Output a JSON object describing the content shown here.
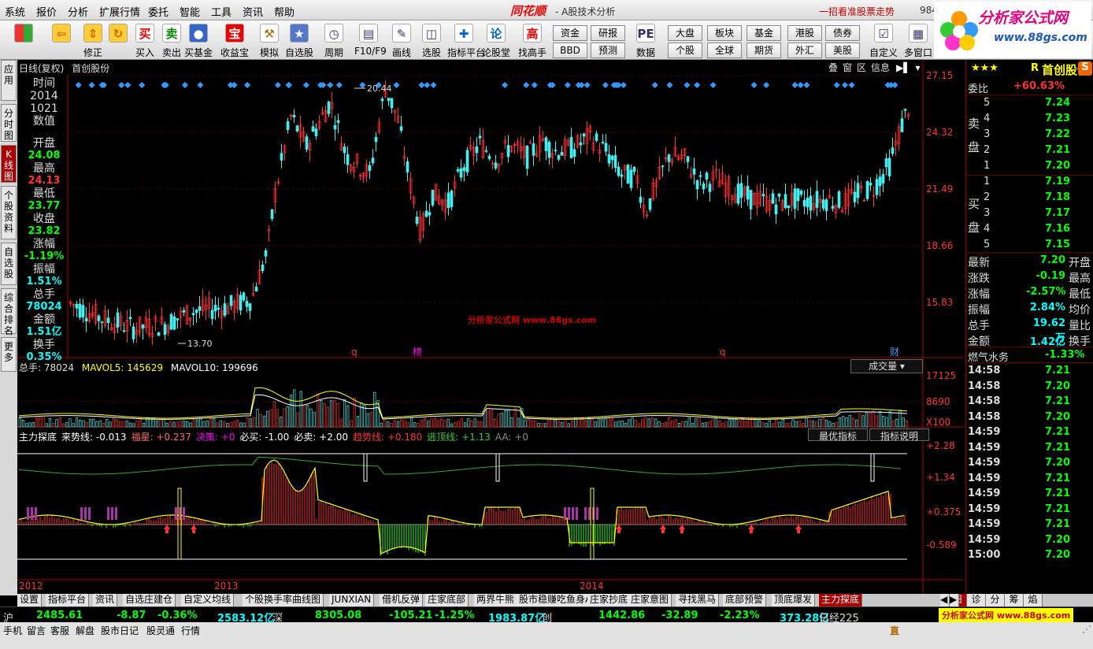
{
  "menu": [
    "系统",
    "报价",
    "分析",
    "扩展行情",
    "委托",
    "智能",
    "工具",
    "资讯",
    "帮助"
  ],
  "app_brand": "同花顺",
  "app_subtitle": "- A股技术分析",
  "promo": "一招看准股票走势",
  "menu_num": "984",
  "toolbar": [
    {
      "label": "",
      "icon": "grid-icon",
      "bg": "#e33",
      "fg": "#ff0"
    },
    {
      "label": "",
      "icon": "back-arrow-icon",
      "bg": "#fc3",
      "fg": "#c60"
    },
    {
      "label": "修正",
      "icon": "up-down-icon",
      "bg": "#fc3",
      "fg": "#c60"
    },
    {
      "label": "",
      "icon": "refresh-icon",
      "bg": "#fc3",
      "fg": "#c60"
    },
    {
      "label": "买入",
      "icon": "买",
      "bg": "#fff",
      "fg": "#e00"
    },
    {
      "label": "卖出",
      "icon": "卖",
      "bg": "#fff",
      "fg": "#080"
    },
    {
      "label": "买基金",
      "icon": "●",
      "bg": "#36c",
      "fg": "#fff"
    },
    {
      "label": "收益宝",
      "icon": "宝",
      "bg": "#e00",
      "fg": "#fff"
    },
    {
      "label": "模拟",
      "icon": "⚒",
      "bg": "#fff",
      "fg": "#a60"
    },
    {
      "label": "自选股",
      "icon": "★",
      "bg": "#57c",
      "fg": "#fff"
    },
    {
      "label": "周期",
      "icon": "◷",
      "bg": "#fff",
      "fg": "#336"
    },
    {
      "label": "F10/F9",
      "icon": "▤",
      "bg": "#fff",
      "fg": "#336"
    },
    {
      "label": "画线",
      "icon": "✎",
      "bg": "#fff",
      "fg": "#336"
    },
    {
      "label": "选股",
      "icon": "◫",
      "bg": "#fff",
      "fg": "#336"
    },
    {
      "label": "指标平台",
      "icon": "✚",
      "bg": "#fff",
      "fg": "#06c"
    },
    {
      "label": "论股堂",
      "icon": "论",
      "bg": "#fff",
      "fg": "#06c"
    },
    {
      "label": "找高手",
      "icon": "高",
      "bg": "#fff",
      "fg": "#e00"
    },
    {
      "label": "数据",
      "icon": "PE",
      "bg": "#fff",
      "fg": "#336"
    },
    {
      "label": "自定义",
      "icon": "☑",
      "bg": "#fff",
      "fg": "#336"
    },
    {
      "label": "多窗口",
      "icon": "▦",
      "bg": "#fff",
      "fg": "#336"
    }
  ],
  "small_buttons": [
    "资金",
    "BBD",
    "研报",
    "预测",
    "大盘",
    "个股",
    "板块",
    "全球",
    "基金",
    "期货",
    "港股",
    "外汇",
    "债券",
    "美股"
  ],
  "logo": {
    "name": "分析家公式网",
    "url": "www.88gs.com"
  },
  "left_tabs": [
    "应用",
    "分时图",
    "K线图",
    "个股资料",
    "自选股",
    "综合排名",
    "更多"
  ],
  "chart_header": {
    "mode": "日线(复权)",
    "name": "首创股份"
  },
  "chart_buttons": [
    "叠",
    "窗",
    "区",
    "信息"
  ],
  "info_panel": {
    "time_label": "时间",
    "year": "2014",
    "date": "1021",
    "value_label": "数值",
    "items": [
      {
        "k": "开盘",
        "v": "24.08",
        "c": "grn"
      },
      {
        "k": "最高",
        "v": "24.13",
        "c": "red"
      },
      {
        "k": "最低",
        "v": "23.77",
        "c": "grn"
      },
      {
        "k": "收盘",
        "v": "23.82",
        "c": "grn"
      },
      {
        "k": "涨幅",
        "v": "-1.19%",
        "c": "grn"
      },
      {
        "k": "振幅",
        "v": "1.51%",
        "c": "cyan"
      },
      {
        "k": "总手",
        "v": "78024",
        "c": "cyan"
      },
      {
        "k": "金额",
        "v": "1.51亿",
        "c": "cyan"
      },
      {
        "k": "换手",
        "v": "0.35%",
        "c": "cyan"
      }
    ]
  },
  "price_axis": [
    "27.15",
    "24.32",
    "21.49",
    "18.66",
    "15.83"
  ],
  "high_label": "20.44",
  "low_label": "13.70",
  "watermark": "分析家公式网 www.88gs.com",
  "markers": [
    "q",
    "榜",
    "q",
    "财"
  ],
  "vol_header": {
    "a": "总手: 78024",
    "b": "MAVOL5: 145629",
    "c": "MAVOL10: 199696",
    "dropdown": "成交量"
  },
  "vol_axis": [
    "17125",
    "8690",
    "X100"
  ],
  "ind_header": [
    {
      "t": "主力探底",
      "c": "#fff"
    },
    {
      "t": "来势线: -0.013",
      "c": "#fff"
    },
    {
      "t": "福星: +0.237",
      "c": "#f66"
    },
    {
      "t": "决策: +0",
      "c": "#f0f"
    },
    {
      "t": "必买: -1.00",
      "c": "#fff"
    },
    {
      "t": "必卖: +2.00",
      "c": "#fff"
    },
    {
      "t": "趋势线: +0.180",
      "c": "#f33"
    },
    {
      "t": "逃顶线: +1.13",
      "c": "#3c3"
    },
    {
      "t": "AA: +0",
      "c": "#888"
    }
  ],
  "ind_buttons": [
    "最优指标",
    "指标说明"
  ],
  "ind_axis": [
    "+2.28",
    "+1.34",
    "+0.375",
    "-0.589"
  ],
  "time_axis": [
    "2012",
    "2013",
    "2014"
  ],
  "bottom_tabs": [
    "设置",
    "指标平台",
    "资讯",
    "自选庄建仓",
    "自定义均线",
    "个股换手率曲线图",
    "JUNXIAN",
    "借机反弹",
    "庄家底部",
    "两界牛熊",
    "股市稳赚吃鱼身A",
    "庄家抄底",
    "庄家意图",
    "寻找黑马",
    "底部预警",
    "顶底爆发",
    "主力探底"
  ],
  "right_tabs": [
    "细",
    "诊",
    "分",
    "筹",
    "焰"
  ],
  "quote": {
    "stars": "★★★",
    "flag": "R",
    "name": "首创股份",
    "weibi_label": "委比",
    "weibi": "+60.63%",
    "sell_label": [
      "卖",
      "盘"
    ],
    "buy_label": [
      "买",
      "盘"
    ],
    "sell": [
      {
        "n": "5",
        "p": "7.24"
      },
      {
        "n": "4",
        "p": "7.23"
      },
      {
        "n": "3",
        "p": "7.22"
      },
      {
        "n": "2",
        "p": "7.21"
      },
      {
        "n": "1",
        "p": "7.20"
      }
    ],
    "buy": [
      {
        "n": "1",
        "p": "7.19"
      },
      {
        "n": "2",
        "p": "7.18"
      },
      {
        "n": "3",
        "p": "7.17"
      },
      {
        "n": "4",
        "p": "7.16"
      },
      {
        "n": "5",
        "p": "7.15"
      }
    ],
    "stats": [
      {
        "k": "最新",
        "v": "7.20",
        "c": "grn",
        "k2": "开盘"
      },
      {
        "k": "涨跌",
        "v": "-0.19",
        "c": "grn",
        "k2": "最高"
      },
      {
        "k": "涨幅",
        "v": "-2.57%",
        "c": "grn",
        "k2": "最低"
      },
      {
        "k": "振幅",
        "v": "2.84%",
        "c": "cyan",
        "k2": "均价"
      },
      {
        "k": "总手",
        "v": "19.62万",
        "c": "cyan",
        "k2": "量比"
      },
      {
        "k": "金额",
        "v": "1.42亿",
        "c": "cyan",
        "k2": "换手"
      }
    ],
    "sector": "燃气水务",
    "sector_chg": "-1.33%",
    "ticks": [
      {
        "t": "14:58",
        "p": "7.21"
      },
      {
        "t": "14:58",
        "p": "7.20"
      },
      {
        "t": "14:58",
        "p": "7.21"
      },
      {
        "t": "14:58",
        "p": "7.20"
      },
      {
        "t": "14:59",
        "p": "7.21"
      },
      {
        "t": "14:59",
        "p": "7.21"
      },
      {
        "t": "14:59",
        "p": "7.20"
      },
      {
        "t": "14:59",
        "p": "7.21"
      },
      {
        "t": "14:59",
        "p": "7.21"
      },
      {
        "t": "14:59",
        "p": "7.21"
      },
      {
        "t": "14:59",
        "p": "7.21"
      },
      {
        "t": "14:59",
        "p": "7.20"
      },
      {
        "t": "15:00",
        "p": "7.20"
      }
    ]
  },
  "index_bar": [
    {
      "t": "沪",
      "c": "wht"
    },
    {
      "t": "2485.61",
      "c": "grn"
    },
    {
      "t": "-8.87",
      "c": "grn"
    },
    {
      "t": "-0.36%",
      "c": "grn"
    },
    {
      "t": "2583.12亿",
      "c": "cyan"
    },
    {
      "t": "深",
      "c": "wht"
    },
    {
      "t": "8305.08",
      "c": "grn"
    },
    {
      "t": "-105.21",
      "c": "grn"
    },
    {
      "t": "-1.25%",
      "c": "grn"
    },
    {
      "t": "1983.87亿",
      "c": "cyan"
    },
    {
      "t": "创",
      "c": "wht"
    },
    {
      "t": "1442.86",
      "c": "grn"
    },
    {
      "t": "-32.89",
      "c": "grn"
    },
    {
      "t": "-2.23%",
      "c": "grn"
    },
    {
      "t": "373.28亿",
      "c": "cyan"
    },
    {
      "t": "日经225",
      "c": "wht"
    }
  ],
  "index_promo": "分析家公式网 www.88gs.com",
  "status": [
    "手机",
    "留言",
    "客服",
    "解盘",
    "股市日记",
    "股灵通",
    "行情"
  ],
  "status_right": "直"
}
